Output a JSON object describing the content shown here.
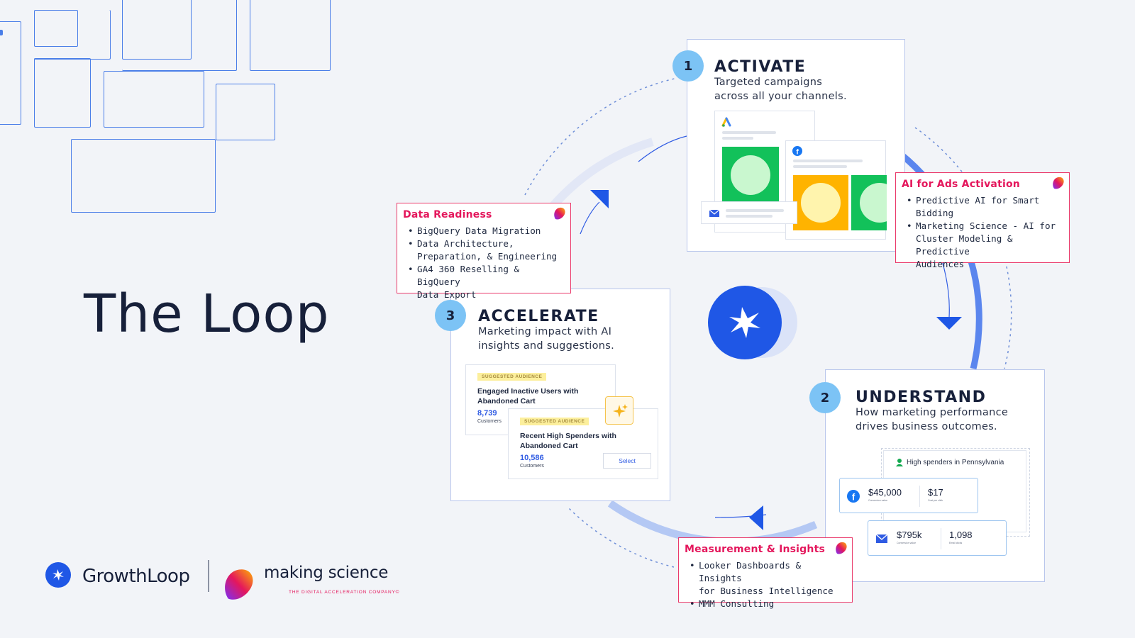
{
  "title": "The Loop",
  "steps": [
    {
      "num": "1",
      "title": "ACTIVATE",
      "desc_line1": "Targeted campaigns",
      "desc_line2": "across all your channels."
    },
    {
      "num": "2",
      "title": "UNDERSTAND",
      "desc_line1": "How marketing performance",
      "desc_line2": "drives business outcomes."
    },
    {
      "num": "3",
      "title": "ACCELERATE",
      "desc_line1": "Marketing impact with AI",
      "desc_line2": "insights and suggestions."
    }
  ],
  "services": {
    "data_readiness": {
      "title": "Data Readiness",
      "items": [
        "BigQuery Data Migration",
        "Data Architecture,",
        "Preparation, & Engineering",
        "GA4 360 Reselling & BigQuery",
        "Data Export"
      ]
    },
    "ai_ads": {
      "title": "AI for Ads Activation",
      "items": [
        "Predictive AI for Smart",
        "Bidding",
        "Marketing Science - AI for",
        "Cluster Modeling & Predictive",
        "Audiences"
      ]
    },
    "measurement": {
      "title": "Measurement & Insights",
      "items": [
        "Looker Dashboards & Insights",
        "for Business Intelligence",
        "MMM Consulting"
      ]
    }
  },
  "accelerate_widget": {
    "card1": {
      "tag": "SUGGESTED AUDIENCE",
      "title_line1": "Engaged Inactive Users with",
      "title_line2": "Abandoned Cart",
      "count": "8,739",
      "count_label": "Customers"
    },
    "card2": {
      "tag": "SUGGESTED AUDIENCE",
      "title_line1": "Recent High Spenders with",
      "title_line2": "Abandoned Cart",
      "count": "10,586",
      "count_label": "Customers",
      "button": "Select"
    }
  },
  "understand_widget": {
    "segment": "High spenders in Pennsylvania",
    "row1": {
      "value1": "$45,000",
      "label1": "Conversion value",
      "value2": "$17",
      "label2": "Cost per click"
    },
    "row2": {
      "value1": "$795k",
      "label1": "Conversion value",
      "value2": "1,098",
      "label2": "Email clicks"
    }
  },
  "logos": {
    "growthloop": "GrowthLoop",
    "making_science": "making science",
    "making_science_tagline": "THE DIGITAL ACCELERATION COMPANY©"
  },
  "colors": {
    "accent_blue": "#1f57e6",
    "step_circle": "#7cc3f5",
    "service_red": "#e4175c",
    "loop_ring": "#5b86ee",
    "background": "#f2f4f8"
  }
}
